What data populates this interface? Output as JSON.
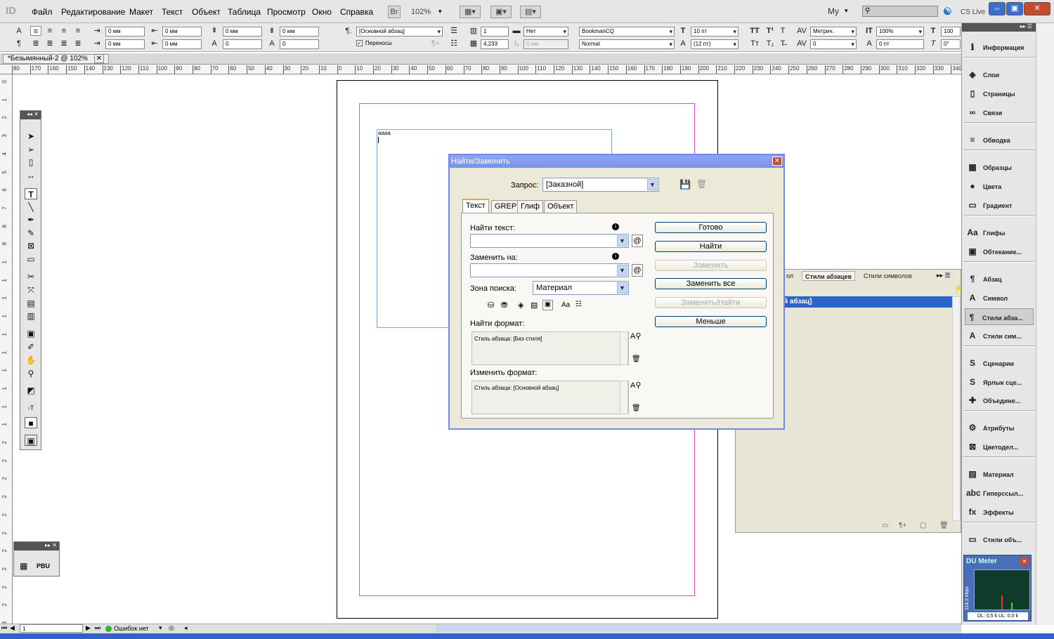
{
  "menubar": {
    "logo": "ID",
    "items": [
      "Файл",
      "Редактирование",
      "Макет",
      "Текст",
      "Объект",
      "Таблица",
      "Просмотр",
      "Окно",
      "Справка"
    ],
    "br": "Br",
    "zoom": "102%",
    "workspace": "My",
    "cslive": "CS Live"
  },
  "control": {
    "zero": "0 мм",
    "frame_pct": "4,233",
    "style": "[Основной абзац]",
    "hyphen": "Переносы",
    "cols": "1",
    "no": "Нет",
    "dis": "0 мм",
    "font": "BookmanCQ",
    "font_style": "Normal",
    "size": "10 пт",
    "leading": "(12 пт)",
    "kern": "Метрич.",
    "track": "0",
    "scale": "100%",
    "base": "0 пт",
    "angle": "0°",
    "hundred": "100"
  },
  "doc": {
    "tab": "*Безымянный-2 @ 102%",
    "text": "aaaa"
  },
  "hruler": [
    "80",
    "170",
    "160",
    "150",
    "140",
    "130",
    "120",
    "110",
    "100",
    "90",
    "80",
    "70",
    "60",
    "50",
    "40",
    "30",
    "20",
    "10",
    "0",
    "10",
    "20",
    "30",
    "40",
    "50",
    "60",
    "70",
    "80",
    "90",
    "100",
    "110",
    "120",
    "130",
    "140",
    "150",
    "160",
    "170",
    "180",
    "190",
    "200",
    "210",
    "220",
    "230",
    "240",
    "250",
    "260",
    "270",
    "280",
    "290",
    "300",
    "310",
    "320",
    "330",
    "340"
  ],
  "vruler": [
    "0",
    "1",
    "2",
    "3",
    "4",
    "5",
    "6",
    "7",
    "8",
    "9",
    "1",
    "1",
    "1",
    "1",
    "1",
    "1",
    "1",
    "1",
    "1",
    "1",
    "2",
    "2",
    "2",
    "2",
    "2",
    "2",
    "2",
    "2",
    "2",
    "2",
    "3",
    "3"
  ],
  "pbu": "PBU",
  "stylepanel": {
    "tab0": "ол",
    "tab1": "Стили абзацев",
    "tab2": "Стили символов",
    "selected": "й абзац]"
  },
  "dialog": {
    "title": "Найти/Заменить",
    "query_label": "Запрос:",
    "query_value": "[Заказной]",
    "tabs": [
      "Текст",
      "GREP",
      "Глиф",
      "Объект"
    ],
    "find_label": "Найти текст:",
    "replace_label": "Заменить на:",
    "zone_label": "Зона поиска:",
    "zone_value": "Материал",
    "find_fmt_label": "Найти формат:",
    "find_fmt_value": "Стиль абзаца: [Без стиля]",
    "change_fmt_label": "Изменить формат:",
    "change_fmt_value": "Стиль абзаца: [Основной абзац]",
    "btn_done": "Готово",
    "btn_find": "Найти",
    "btn_replace": "Заменить",
    "btn_replace_all": "Заменить все",
    "btn_replace_find": "Заменить/Найти",
    "btn_less": "Меньше",
    "case_icon": "Aa"
  },
  "dock": [
    "Информация",
    "Слои",
    "Страницы",
    "Связи",
    "Обводка",
    "Образцы",
    "Цвета",
    "Градиент",
    "Глифы",
    "Обтекание...",
    "Абзац",
    "Символ",
    "Стили абза...",
    "Стили сим...",
    "Сценарии",
    "Ярлык сце...",
    "Объедине...",
    "Атрибуты",
    "Цветодел...",
    "Материал",
    "Гиперссыл...",
    "Эффекты",
    "Стили объ..."
  ],
  "dumeter": {
    "title": "DU Meter",
    "rate": "114,2 kbps",
    "readout": "DL: 0,5 k   UL: 0,0 k"
  },
  "status": {
    "page": "1",
    "errors": "Ошибок нет"
  }
}
